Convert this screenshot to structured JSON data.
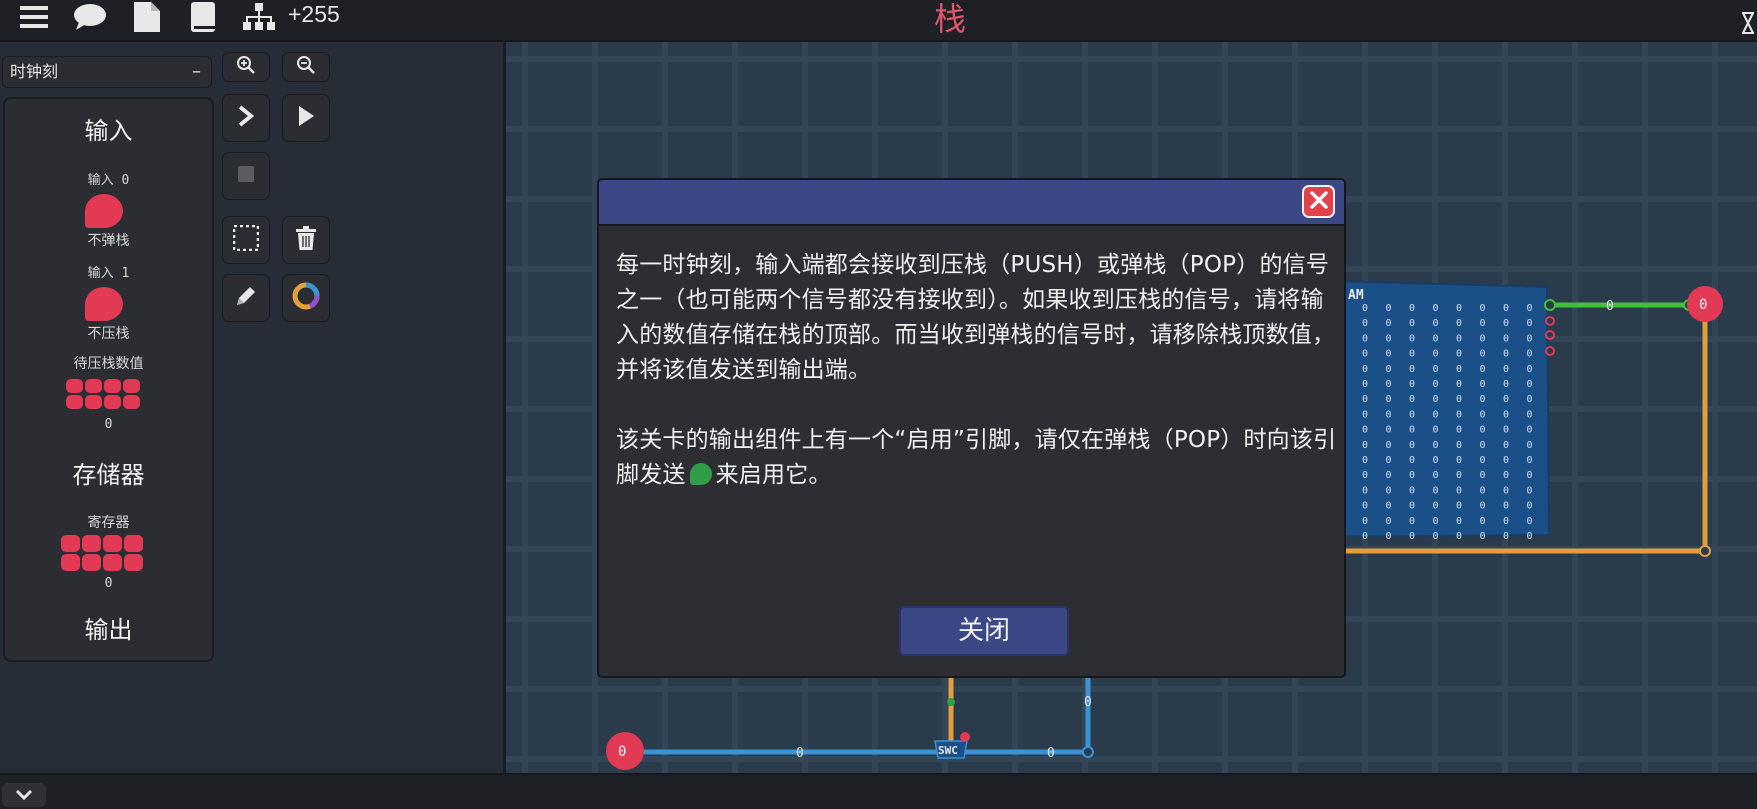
{
  "topbar": {
    "counter": "+255",
    "title": "栈"
  },
  "left": {
    "clock_select": "时钟刻",
    "clock_select_btn": "–",
    "palette": {
      "inputs_heading": "输入",
      "input0_label": "输入 0",
      "input0_caption": "不弹栈",
      "input1_label": "输入 1",
      "input1_caption": "不压栈",
      "push_value_label": "待压栈数值",
      "push_value": "0",
      "storage_heading": "存储器",
      "register_label": "寄存器",
      "register_value": "0",
      "output_heading": "输出"
    }
  },
  "canvas": {
    "ram_label": "AM",
    "wire_values": [
      "0",
      "0",
      "0",
      "0",
      "0"
    ],
    "out_pin_value": "0",
    "in_pin_value": "0",
    "swc_label": "SWC"
  },
  "dialog": {
    "para1": "每一时钟刻，输入端都会接收到压栈（PUSH）或弹栈（POP）的信号之一（也可能两个信号都没有接收到）。如果收到压栈的信号，请将输入的数值存储在栈的顶部。而当收到弹栈的信号时，请移除栈顶数值，并将该值发送到输出端。",
    "para2_a": "该关卡的输出组件上有一个“启用”引脚，请仅在弹栈（POP）时向该引脚发送",
    "para2_b": "来启用它。",
    "close_button": "关闭"
  },
  "colors": {
    "accent_red": "#e23a55",
    "dialog_header": "#3c4785",
    "wire_blue": "#3a93d6",
    "wire_orange": "#e3a03a",
    "wire_green": "#3fc23a",
    "enable_green": "#2f9e46"
  }
}
